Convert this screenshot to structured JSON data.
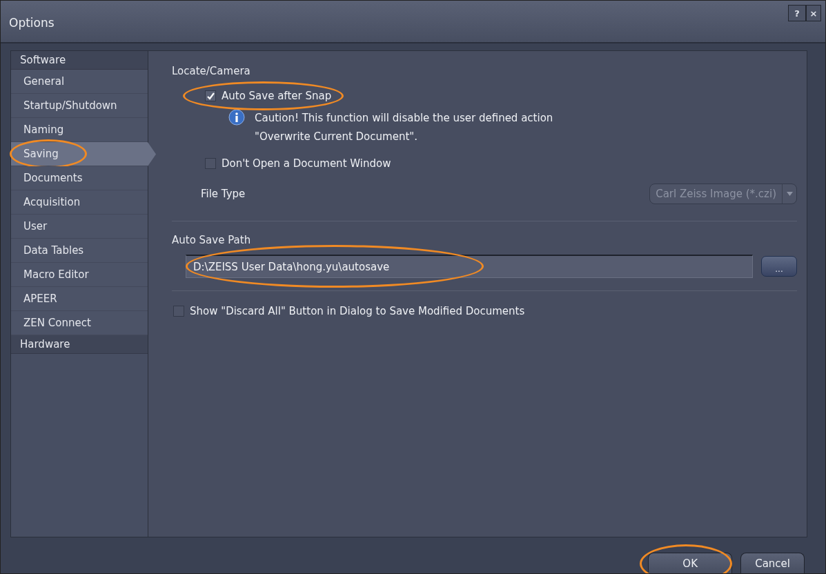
{
  "window": {
    "title": "Options",
    "controls": [
      {
        "kind": "help",
        "label": "?"
      },
      {
        "kind": "close",
        "label": "×"
      }
    ]
  },
  "sidebar": {
    "groups": [
      {
        "label": "Software",
        "items": [
          {
            "label": "General",
            "selected": false,
            "highlighted": false
          },
          {
            "label": "Startup/Shutdown",
            "selected": false,
            "highlighted": false
          },
          {
            "label": "Naming",
            "selected": false,
            "highlighted": false
          },
          {
            "label": "Saving",
            "selected": true,
            "highlighted": true
          },
          {
            "label": "Documents",
            "selected": false,
            "highlighted": false
          },
          {
            "label": "Acquisition",
            "selected": false,
            "highlighted": false
          },
          {
            "label": "User",
            "selected": false,
            "highlighted": false
          },
          {
            "label": "Data Tables",
            "selected": false,
            "highlighted": false
          },
          {
            "label": "Macro Editor",
            "selected": false,
            "highlighted": false
          },
          {
            "label": "APEER",
            "selected": false,
            "highlighted": false
          },
          {
            "label": "ZEN Connect",
            "selected": false,
            "highlighted": false
          }
        ]
      },
      {
        "label": "Hardware"
      }
    ]
  },
  "sections": [
    {
      "title": "Locate/Camera",
      "rows": [
        {
          "kind": "checkbox",
          "label": "Auto Save after Snap",
          "checked": true,
          "highlighted": true
        },
        {
          "kind": "info",
          "lines": [
            "Caution! This function will disable the user defined action",
            "\"Overwrite Current Document\"."
          ]
        },
        {
          "kind": "checkbox",
          "label": "Don't Open a Document Window",
          "checked": false,
          "highlighted": false
        },
        {
          "kind": "dropdown",
          "label": "File Type",
          "value": "Carl Zeiss Image (*.czi)",
          "disabled": true
        }
      ]
    },
    {
      "title": "Auto Save Path",
      "rows": [
        {
          "kind": "path",
          "value": "D:\\ZEISS User Data\\hong.yu\\autosave",
          "highlighted": true,
          "browse": "..."
        }
      ]
    },
    {
      "rows": [
        {
          "kind": "checkbox",
          "label": "Show \"Discard All\" Button in Dialog to Save Modified Documents",
          "checked": false,
          "highlighted": false
        }
      ]
    }
  ],
  "footer": {
    "buttons": [
      {
        "label": "OK",
        "highlighted": true
      },
      {
        "label": "Cancel",
        "highlighted": false
      }
    ]
  }
}
